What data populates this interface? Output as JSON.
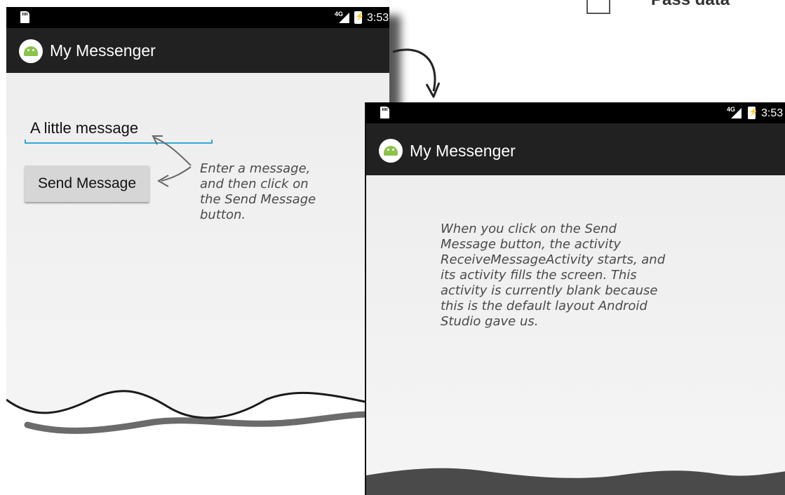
{
  "corner_caption": {
    "text": "Pass data"
  },
  "phone1": {
    "status_bar": {
      "network": "4G",
      "time": "3:53"
    },
    "action_bar": {
      "title": "My Messenger",
      "icon": "android-app-icon"
    },
    "message_field": {
      "value": "A little message"
    },
    "send_button": {
      "label": "Send Message"
    },
    "annotation": {
      "text": "Enter a message,\nand then click on\nthe Send Message\nbutton."
    }
  },
  "phone2": {
    "status_bar": {
      "network": "4G",
      "time": "3:53"
    },
    "action_bar": {
      "title": "My Messenger",
      "icon": "android-app-icon"
    },
    "annotation": {
      "text": "When you click on the Send\nMessage button, the activity\nReceiveMessageActivity starts, and\nits activity fills the screen. This\nactivity is currently blank because\nthis is the default layout Android\nStudio gave us."
    }
  },
  "colors": {
    "status_bar": "#000000",
    "action_bar": "#212121",
    "screen_background": "#eeeeee",
    "edit_text_underline": "#33a9d6",
    "button": "#d6d6d6",
    "annotation_ink": "#4a4a4a"
  }
}
